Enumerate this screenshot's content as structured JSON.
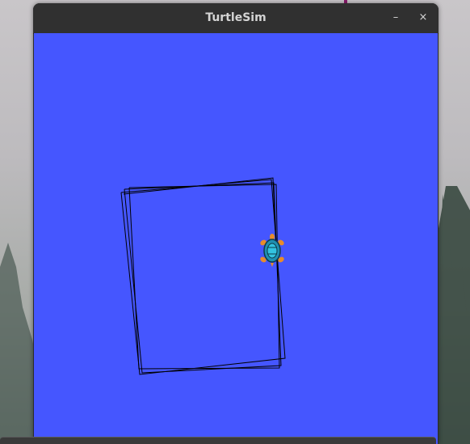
{
  "window": {
    "title": "TurtleSim",
    "minimize_glyph": "–",
    "close_glyph": "×",
    "icons": {
      "minimize": "minimize-icon",
      "close": "close-icon"
    }
  },
  "canvas": {
    "background_color": "#4556ff",
    "pen_color": "#000000",
    "turtle": "turtle-icon"
  }
}
